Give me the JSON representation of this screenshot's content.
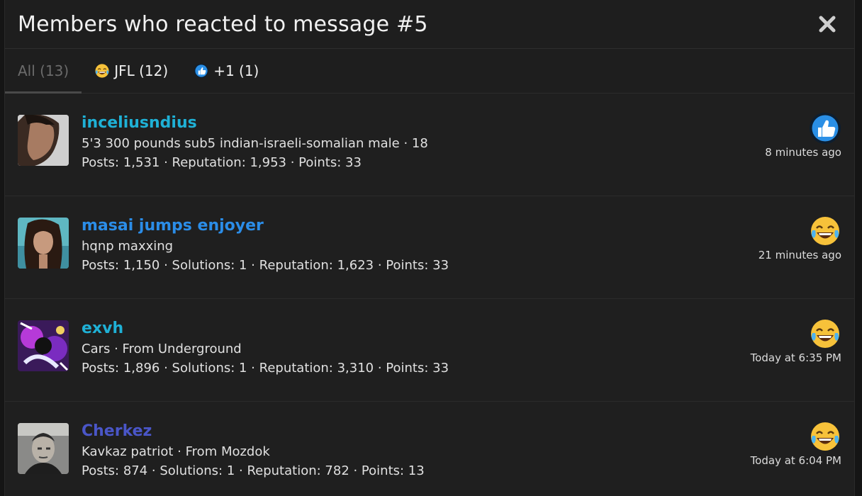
{
  "dialog": {
    "title": "Members who reacted to message #5"
  },
  "tabs": [
    {
      "label": "All (13)",
      "icon": null,
      "active": true
    },
    {
      "label": "JFL (12)",
      "icon": "crying-laughing-emoji-icon"
    },
    {
      "label": "+1 (1)",
      "icon": "thumbs-up-icon"
    }
  ],
  "members": [
    {
      "name": "inceliusndius",
      "name_color": "#1fb1d6",
      "bio": "5'3 300 pounds sub5 indian-israeli-somalian male · 18",
      "stats": "Posts: 1,531 · Reputation: 1,953 · Points: 33",
      "reaction": "thumbs-up-icon",
      "time": "8 minutes ago"
    },
    {
      "name": "masai jumps enjoyer",
      "name_color": "#2b8de8",
      "bio": "hqnp maxxing",
      "stats": "Posts: 1,150 · Solutions: 1 · Reputation: 1,623 · Points: 33",
      "reaction": "crying-laughing-emoji-icon",
      "time": "21 minutes ago"
    },
    {
      "name": "exvh",
      "name_color": "#1fb1d6",
      "bio": "Cars · From Underground",
      "stats": "Posts: 1,896 · Solutions: 1 · Reputation: 3,310 · Points: 33",
      "reaction": "crying-laughing-emoji-icon",
      "time": "Today at 6:35 PM"
    },
    {
      "name": "Cherkez",
      "name_color": "#4a56c8",
      "bio": "Kavkaz patriot · From Mozdok",
      "stats": "Posts: 874 · Solutions: 1 · Reputation: 782 · Points: 13",
      "reaction": "crying-laughing-emoji-icon",
      "time": "Today at 6:04 PM"
    }
  ]
}
